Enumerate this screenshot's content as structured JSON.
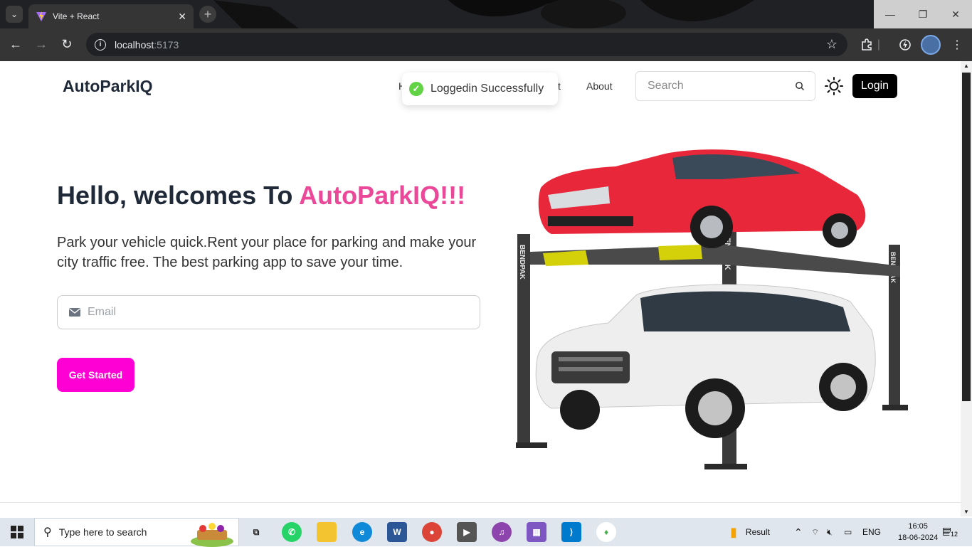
{
  "browser": {
    "tab_title": "Vite + React",
    "tab_close": "✕",
    "new_tab": "+",
    "url_host": "localhost",
    "url_port": ":5173",
    "window_controls": [
      "—",
      "❐",
      "✕"
    ]
  },
  "navbar": {
    "brand": "AutoParkIQ",
    "links": [
      "H",
      "ct",
      "About"
    ],
    "search_placeholder": "Search",
    "login_label": "Login"
  },
  "toast": {
    "message": "Loggedin Successfully"
  },
  "hero": {
    "title_prefix": "Hello, welcomes To ",
    "title_accent": "AutoParkIQ!!!",
    "description": "Park your vehicle quick.Rent your place for parking and make your city traffic free. The best parking app to save your time.",
    "email_placeholder": "Email",
    "cta_label": "Get Started"
  },
  "image_labels": [
    "BENDPAK",
    "BENDPAK",
    "BENDPAK"
  ],
  "taskbar": {
    "search_placeholder": "Type here to search",
    "result_label": "Result",
    "language": "ENG",
    "time": "16:05",
    "date": "18-06-2024",
    "notification_count": "12"
  },
  "colors": {
    "accent_pink": "#ec4899",
    "cta": "#ff00d4",
    "toast_success": "#61d345"
  }
}
